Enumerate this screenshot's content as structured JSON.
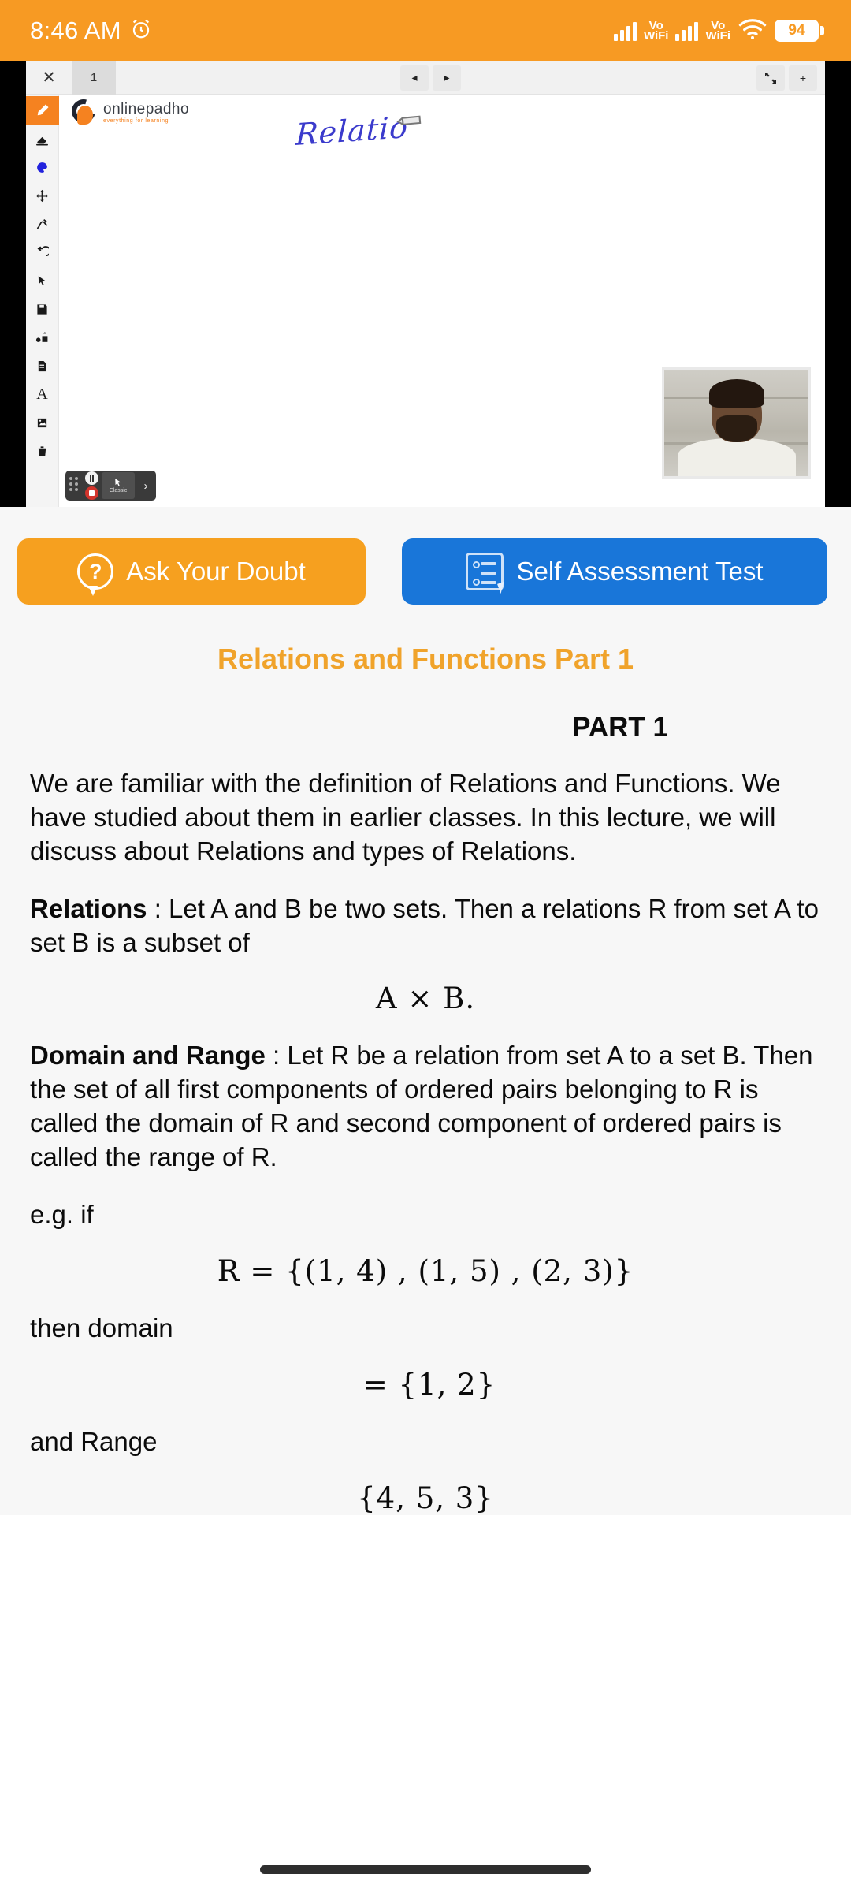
{
  "status_bar": {
    "time": "8:46 AM",
    "alarm_icon": "alarm-clock-icon",
    "signal_1_label": "Vo",
    "signal_1_sub": "WiFi",
    "signal_2_label": "Vo",
    "signal_2_sub": "WiFi",
    "wifi_icon": "wifi-icon",
    "battery_level": "94",
    "background_color": "#F79A23"
  },
  "player": {
    "whiteboard": {
      "close_label": "✕",
      "tab_label": "1",
      "nav_prev": "◂",
      "nav_next": "▸",
      "fit_icon": "fit-screen-icon",
      "add_label": "+",
      "logo_name": "onlinepadho",
      "logo_tagline": "everything for learning",
      "handwritten_note": "Relatio",
      "pen_cursor_icon": "pencil-cursor-icon",
      "tools": [
        {
          "name": "pen-tool",
          "glyph": "✎",
          "active": true
        },
        {
          "name": "eraser-tool",
          "glyph": "☁",
          "active": false
        },
        {
          "name": "color-palette-tool",
          "glyph": "❦",
          "active": false
        },
        {
          "name": "move-tool",
          "glyph": "✥",
          "active": false
        },
        {
          "name": "shapes-tool",
          "glyph": "⤴",
          "active": false
        },
        {
          "name": "undo-tool",
          "glyph": "↺",
          "active": false
        },
        {
          "name": "pointer-tool",
          "glyph": "➤",
          "active": false
        },
        {
          "name": "save-tool",
          "glyph": "▣",
          "active": false
        },
        {
          "name": "objects-tool",
          "glyph": "▬",
          "active": false
        },
        {
          "name": "page-tool",
          "glyph": "▤",
          "active": false
        },
        {
          "name": "text-tool",
          "glyph": "A",
          "active": false
        },
        {
          "name": "image-tool",
          "glyph": "▨",
          "active": false
        },
        {
          "name": "delete-tool",
          "glyph": "☒",
          "active": false
        }
      ]
    },
    "float_controls": {
      "pause_label": "pause",
      "record_label": "record",
      "mode_label": "Classic",
      "expand_label": "›"
    },
    "webcam_label": "instructor-webcam"
  },
  "actions": {
    "ask_doubt": {
      "label": "Ask Your Doubt",
      "icon": "question-bubble-icon",
      "color": "#F6A01F"
    },
    "self_test": {
      "label": "Self Assessment Test",
      "icon": "checklist-cursor-icon",
      "color": "#1976D9"
    }
  },
  "lesson": {
    "title": "Relations and Functions Part 1",
    "title_color": "#F0A32B",
    "part_heading": "PART 1",
    "intro": "We are familiar with the definition of Relations and Functions. We have studied about them in earlier classes. In this lecture, we will discuss about Relations and types of Relations.",
    "relations_term": "Relations",
    "relations_text": " : Let A and B be two sets. Then a relations R from set A to set B is a subset of",
    "relations_formula": "A × B.",
    "domain_range_term": "Domain and Range",
    "domain_range_text": " : Let R be a relation from set A to a set B. Then the set of all first components of ordered pairs belonging to R is called the domain of R and second component of ordered pairs is called the range of R.",
    "example_intro": "e.g. if",
    "example_relation": "R = {(1, 4) , (1, 5) , (2, 3)}",
    "then_domain_label": "then domain",
    "domain_value": "=  {1, 2}",
    "and_range_label": "and Range",
    "range_value": "{4, 5, 3}"
  },
  "navigation_bar": {
    "gesture_pill": "home-gesture-pill"
  }
}
